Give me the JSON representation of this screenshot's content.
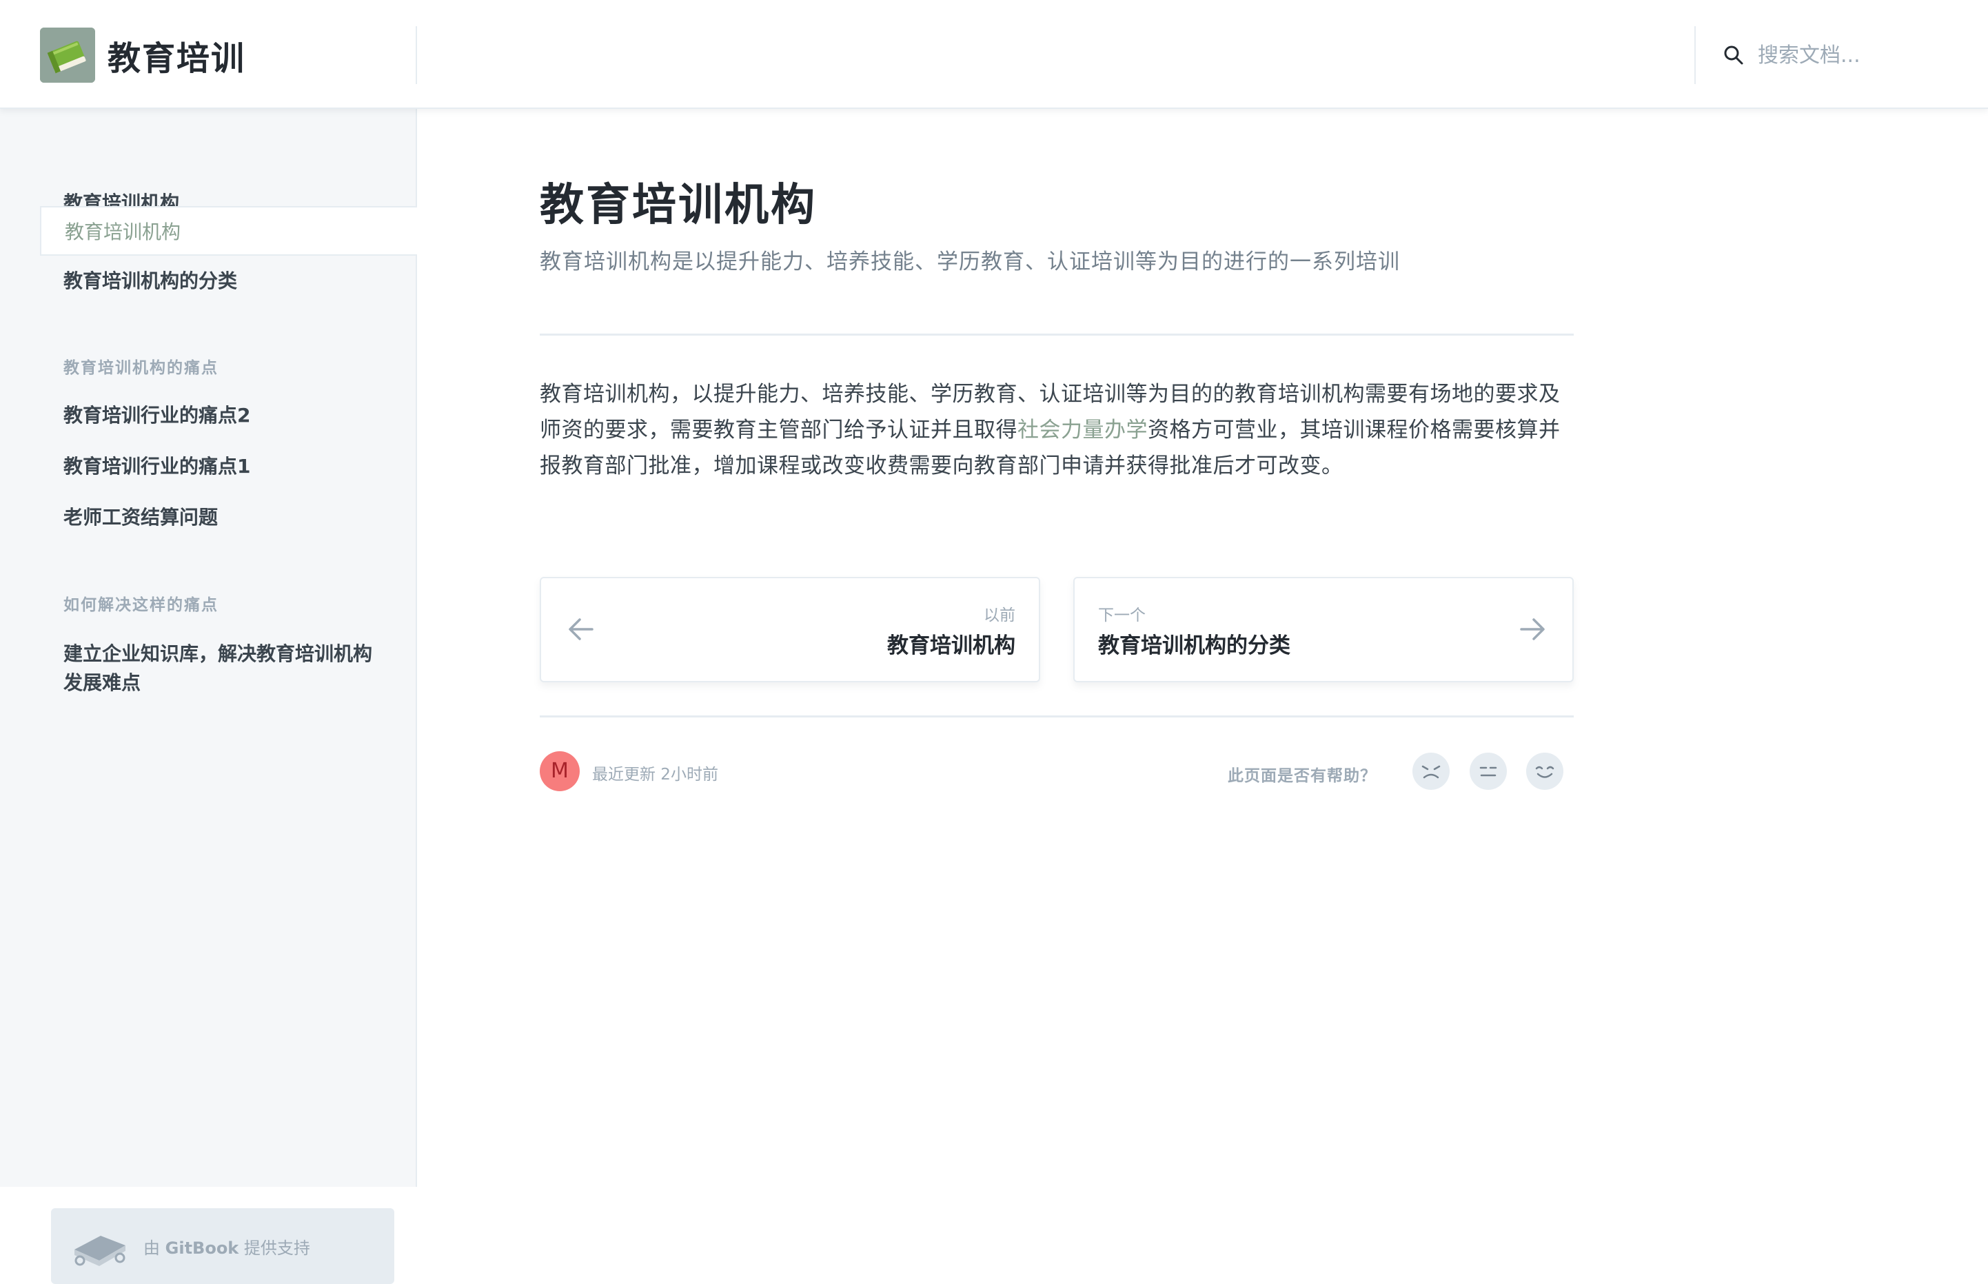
{
  "header": {
    "site_title": "教育培训",
    "search_placeholder": "搜索文档..."
  },
  "sidebar": {
    "items": [
      {
        "label": "教育培训机构"
      },
      {
        "label": "教育培训机构"
      },
      {
        "label": "教育培训机构的分类"
      }
    ],
    "groups": [
      {
        "title": "教育培训机构的痛点",
        "items": [
          {
            "label": "教育培训行业的痛点2"
          },
          {
            "label": "教育培训行业的痛点1"
          },
          {
            "label": "老师工资结算问题"
          }
        ]
      },
      {
        "title": "如何解决这样的痛点",
        "items": [
          {
            "label": "建立企业知识库，解决教育培训机构发展难点"
          }
        ]
      }
    ],
    "powered_prefix": "由 ",
    "powered_brand": "GitBook",
    "powered_suffix": " 提供支持"
  },
  "page": {
    "title": "教育培训机构",
    "description": "教育培训机构是以提升能力、培养技能、学历教育、认证培训等为目的进行的一系列培训",
    "body_before_link": " 教育培训机构，以提升能力、培养技能、学历教育、认证培训等为目的的教育培训机构需要有场地的要求及师资的要求，需要教育主管部门给予认证并且取得",
    "body_link": "社会力量办学",
    "body_after_link": "资格方可营业，其培训课程价格需要核算并报教育部门批准，增加课程或改变收费需要向教育部门申请并获得批准后才可改变。"
  },
  "pager": {
    "prev_caption": "以前",
    "prev_title": "教育培训机构",
    "next_caption": "下一个",
    "next_title": "教育培训机构的分类"
  },
  "footer": {
    "avatar_letter": "M",
    "updated": "最近更新 2小时前",
    "helpful": "此页面是否有帮助？"
  },
  "colors": {
    "accent": "#8aa191",
    "avatar_bg": "#f77d7d",
    "sidebar_bg": "#f5f7f9",
    "border": "#e6ecf1"
  }
}
